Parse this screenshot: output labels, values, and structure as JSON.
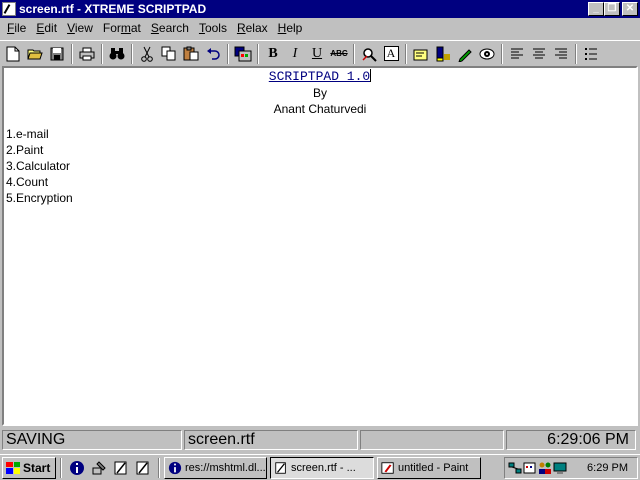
{
  "window": {
    "title": "screen.rtf - XTREME SCRIPTPAD"
  },
  "menu": [
    {
      "accel": "F",
      "rest": "ile"
    },
    {
      "accel": "E",
      "rest": "dit"
    },
    {
      "accel": "V",
      "rest": "iew"
    },
    {
      "pre": "For",
      "accel": "m",
      "rest": "at"
    },
    {
      "accel": "S",
      "rest": "earch"
    },
    {
      "accel": "T",
      "rest": "ools"
    },
    {
      "accel": "R",
      "rest": "elax"
    },
    {
      "accel": "H",
      "rest": "elp"
    }
  ],
  "toolbar": {
    "bold": "B",
    "italic": "I",
    "underline": "U",
    "strike": "ABC",
    "font": "A"
  },
  "document": {
    "title": "SCRIPTPAD 1.0",
    "by": "By",
    "author": "Anant Chaturvedi",
    "items": [
      "1.e-mail",
      "2.Paint",
      "3.Calculator",
      "4.Count",
      "5.Encryption"
    ]
  },
  "status": {
    "state": "SAVING",
    "file": "screen.rtf",
    "empty": "",
    "time": "6:29:06 PM"
  },
  "taskbar": {
    "start": "Start",
    "tasks": [
      {
        "label": "res://mshtml.dl...",
        "icon": "info-icon"
      },
      {
        "label": "screen.rtf - ...",
        "icon": "scriptpad-icon",
        "active": true
      },
      {
        "label": "untitled - Paint",
        "icon": "paint-icon"
      }
    ],
    "clock": "6:29 PM"
  },
  "colors": {
    "titlebar": "#000080",
    "face": "#c0c0c0",
    "doc_title": "#000080"
  }
}
